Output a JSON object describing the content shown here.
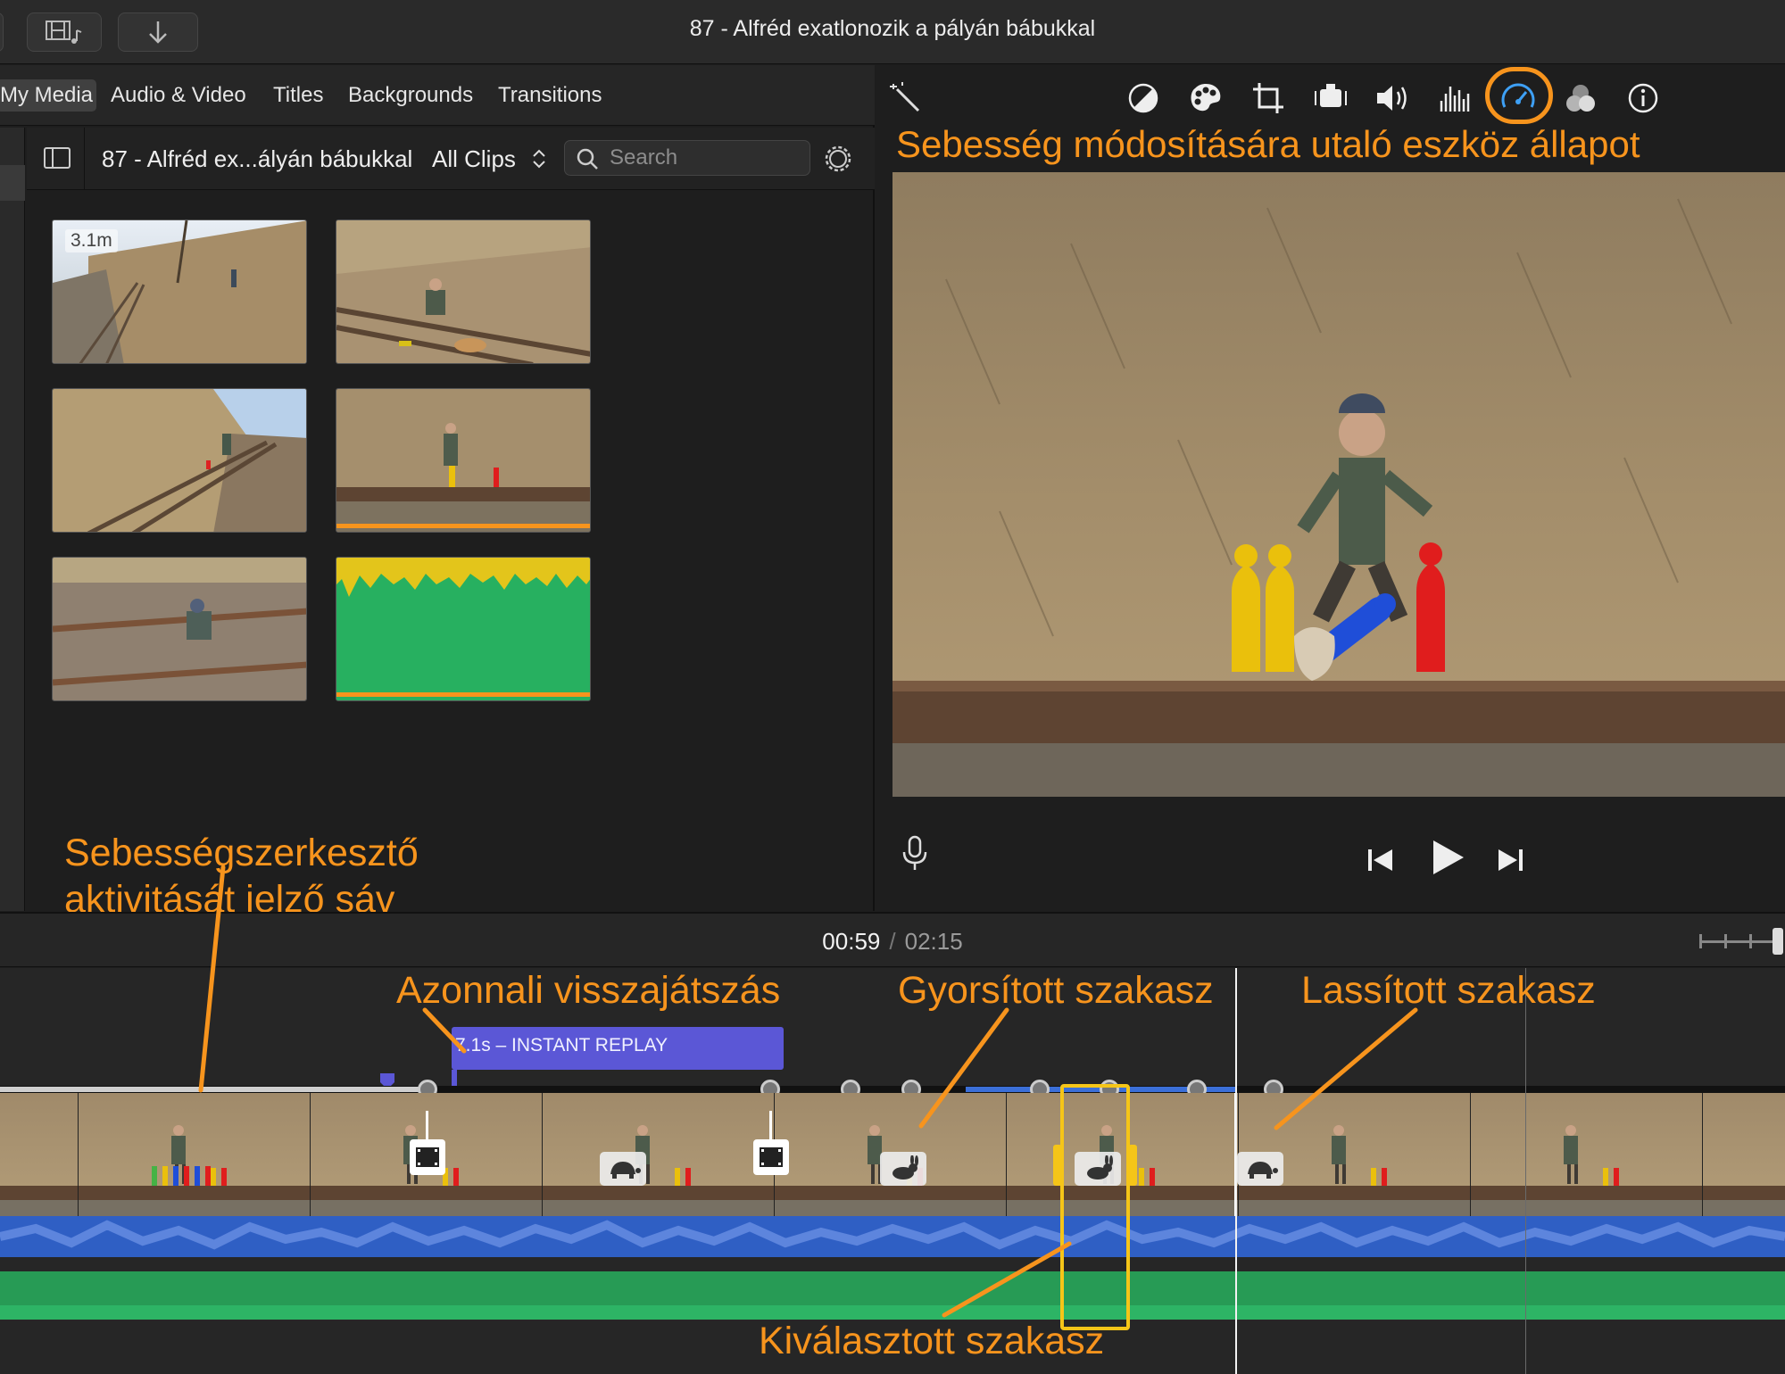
{
  "window": {
    "title": "87 - Alfréd exatlonozik a pályán bábukkal"
  },
  "toolbar": {
    "left_buttons": [
      "media-browser-toggle",
      "download"
    ]
  },
  "media_tabs": [
    {
      "label": "My Media",
      "active": true
    },
    {
      "label": "Audio & Video",
      "active": false
    },
    {
      "label": "Titles",
      "active": false
    },
    {
      "label": "Backgrounds",
      "active": false
    },
    {
      "label": "Transitions",
      "active": false
    }
  ],
  "library": {
    "title": "87 - Alfréd ex...ályán bábukkal",
    "filter": "All Clips",
    "search_placeholder": "Search"
  },
  "clips": [
    {
      "duration_label": "3.1m",
      "used": false,
      "kind": "video"
    },
    {
      "duration_label": "",
      "used": false,
      "kind": "video"
    },
    {
      "duration_label": "",
      "used": false,
      "kind": "video"
    },
    {
      "duration_label": "",
      "used": true,
      "kind": "video"
    },
    {
      "duration_label": "",
      "used": false,
      "kind": "video"
    },
    {
      "duration_label": "",
      "used": true,
      "kind": "audio"
    }
  ],
  "viewer_tools": [
    "magic-wand-icon",
    "color-balance-icon",
    "color-correction-icon",
    "crop-icon",
    "stabilization-icon",
    "volume-icon",
    "noise-reduction-icon",
    "speed-icon",
    "video-overlay-icon",
    "info-icon"
  ],
  "active_tool": "speed-icon",
  "playback": {
    "current": "00:59",
    "separator": "/",
    "total": "02:15"
  },
  "timeline": {
    "instant_replay_label": "7.1s – INSTANT REPLAY",
    "speed_segments": [
      "normal",
      "freeze",
      "slow",
      "freeze",
      "fast",
      "fast-selected",
      "slow"
    ]
  },
  "annotations": {
    "speed_tool_state": "Sebesség módosítására utaló eszköz állapot",
    "speed_editor_bar_line1": "Sebességszerkesztő",
    "speed_editor_bar_line2": "aktivitását jelző sáv",
    "instant_replay": "Azonnali visszajátszás",
    "fast_section": "Gyorsított szakasz",
    "slow_section": "Lassított szakasz",
    "selected_section": "Kiválasztott szakasz"
  },
  "colors": {
    "annotation": "#f7941d",
    "replay_bar": "#5b57d6",
    "audio_waveform": "#2f5fc4",
    "music_track": "#27a35a",
    "selection": "#f5c518"
  }
}
